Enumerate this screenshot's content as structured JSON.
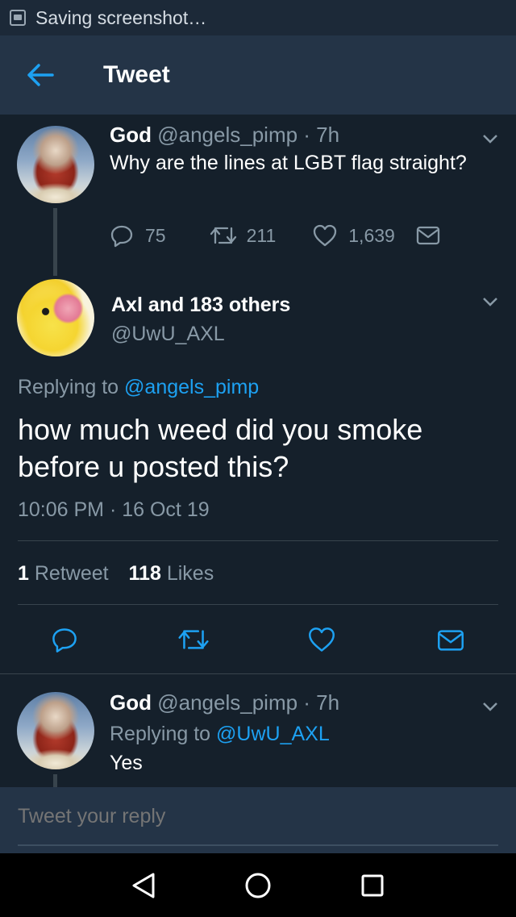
{
  "status_bar": {
    "text": "Saving screenshot…",
    "icon": "screenshot-icon"
  },
  "app_bar": {
    "title": "Tweet",
    "back_icon": "arrow-left-icon"
  },
  "parent_tweet": {
    "name": "God",
    "handle": "@angels_pimp",
    "time": "· 7h",
    "text": "Why are the lines at LGBT flag straight?",
    "replies": "75",
    "retweets": "211",
    "likes": "1,639"
  },
  "main_tweet": {
    "name": "Axl and 183 others",
    "handle": "@UwU_AXL",
    "replying_prefix": "Replying to",
    "replying_to": "@angels_pimp",
    "text_line1": "how much weed did you smoke",
    "text_line2": "before u posted this?",
    "timestamp": "10:06 PM · 16 Oct 19",
    "retweet_count": "1",
    "retweet_label": "Retweet",
    "like_count": "118",
    "like_label": "Likes"
  },
  "reply_tweet": {
    "name": "God",
    "handle": "@angels_pimp",
    "time": "· 7h",
    "replying_prefix": "Replying to",
    "replying_to": "@UwU_AXL",
    "text": "Yes"
  },
  "reply_box": {
    "placeholder": "Tweet your reply"
  },
  "colors": {
    "background": "#15202b",
    "accent": "#1da1f2",
    "muted": "#8899a6",
    "bar": "#243447"
  }
}
